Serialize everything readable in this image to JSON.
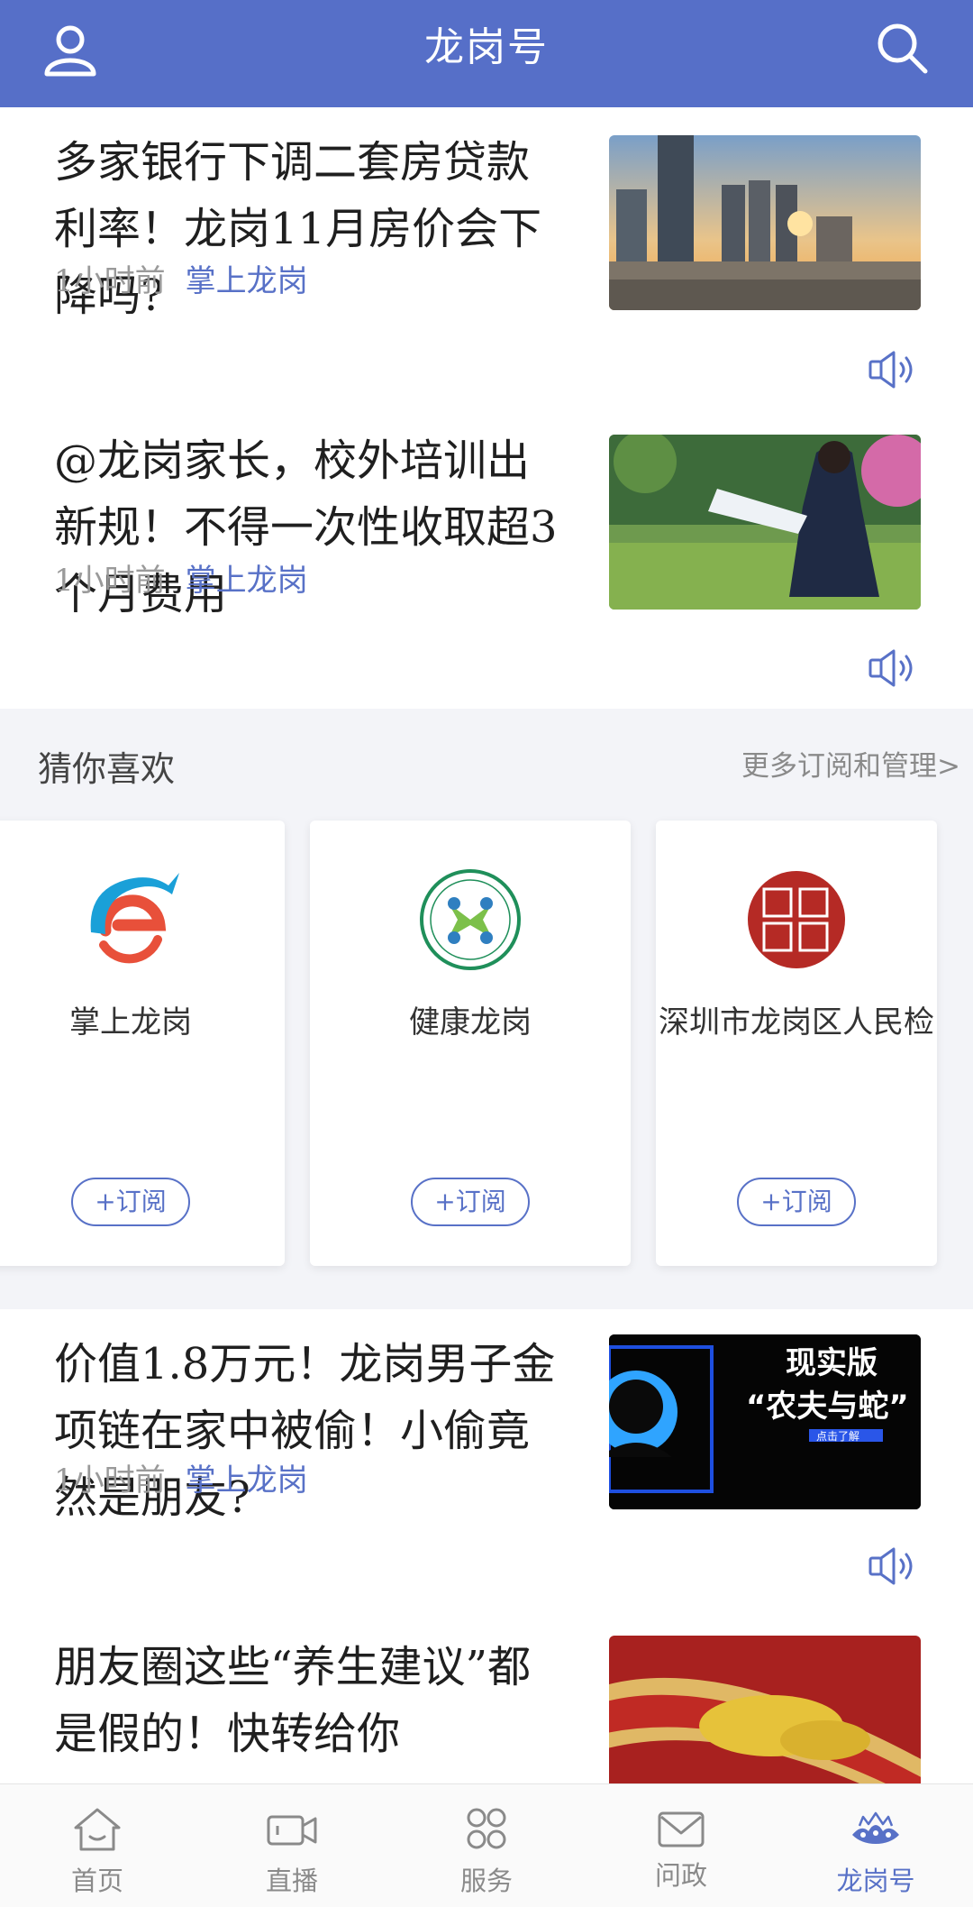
{
  "header": {
    "title": "龙岗号",
    "icons": [
      "user-icon",
      "search-icon"
    ]
  },
  "articles": [
    {
      "title": "多家银行下调二套房贷款利率！龙岗11月房价会下降吗?",
      "time": "1小时前",
      "source": "掌上龙岗",
      "thumb": "city-skyline-sunset"
    },
    {
      "title": "@龙岗家长，校外培训出新规！不得一次性收取超3个月费用",
      "time": "1小时前",
      "source": "掌上龙岗",
      "thumb": "student-reading"
    },
    {
      "title": "价值1.8万元！龙岗男子金项链在家中被偷！小偷竟然是朋友?",
      "time": "1小时前",
      "source": "掌上龙岗",
      "thumb": "video-thumbnail"
    },
    {
      "title": "朋友圈这些“养生建议”都是假的！快转给你",
      "time": "",
      "source": "",
      "thumb": "artery-illustration"
    }
  ],
  "thumb_text": {
    "line1": "现实版",
    "line2": "“农夫与蛇”",
    "tag": "点击了解"
  },
  "recommend": {
    "title": "猜你喜欢",
    "more": "更多订阅和管理>",
    "cards": [
      {
        "name": "掌上龙岗",
        "button": "+订阅"
      },
      {
        "name": "健康龙岗",
        "button": "+订阅"
      },
      {
        "name": "深圳市龙岗区人民检",
        "button": "+订阅"
      }
    ]
  },
  "tabs": [
    {
      "label": "首页",
      "icon": "home-icon",
      "active": false
    },
    {
      "label": "直播",
      "icon": "video-icon",
      "active": false
    },
    {
      "label": "服务",
      "icon": "grid-icon",
      "active": false
    },
    {
      "label": "问政",
      "icon": "mail-icon",
      "active": false
    },
    {
      "label": "龙岗号",
      "icon": "crown-icon",
      "active": true
    }
  ],
  "colors": {
    "brand": "#566fc8",
    "accent": "#5871c7"
  }
}
